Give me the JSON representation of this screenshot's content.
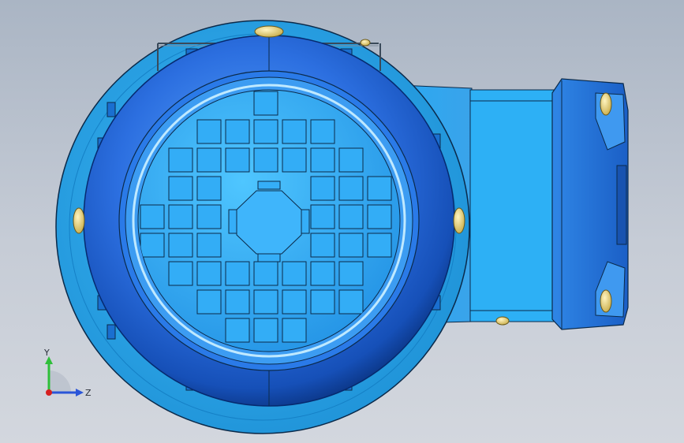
{
  "viewport": {
    "background_top": "#aab5c4",
    "background_bottom": "#d3d7de"
  },
  "model": {
    "flange_color": "#29a8ec",
    "fan_cover_color": "#1f6fd6",
    "gearbox_color": "#2aa7f0",
    "bolt_color": "#e9d57a",
    "edge_color": "#0b2a4a"
  },
  "triad": {
    "y_label": "Y",
    "z_label": "Z",
    "y_color": "#2fbf3a",
    "z_color": "#2a55d8",
    "x_color": "#d62020"
  }
}
